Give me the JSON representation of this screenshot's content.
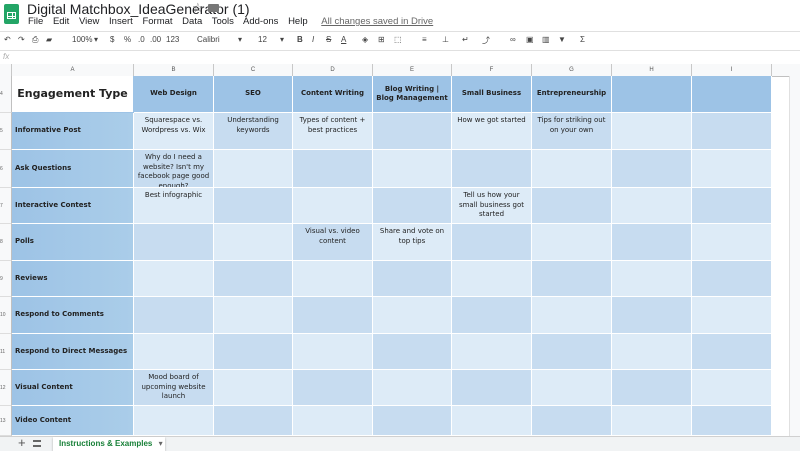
{
  "document": {
    "title": "Digital Matchbox_IdeaGenerator (1)",
    "save_status": "All changes saved in Drive"
  },
  "menu": [
    "File",
    "Edit",
    "View",
    "Insert",
    "Format",
    "Data",
    "Tools",
    "Add-ons",
    "Help"
  ],
  "toolbar": {
    "zoom": "100%",
    "currency": "$",
    "percent": "%",
    "decimal_less": ".0",
    "decimal_more": ".00",
    "more_formats": "123",
    "font": "Calibri",
    "font_size": "12",
    "bold": "B",
    "italic": "I",
    "strike": "S",
    "text_color": "A"
  },
  "formula": {
    "fx": "fx"
  },
  "columns": [
    "A",
    "B",
    "C",
    "D",
    "E",
    "F",
    "G",
    "H",
    "I"
  ],
  "rows": [
    {
      "num": "4",
      "label": "Engagement Type",
      "cells": [
        "Web Design",
        "SEO",
        "Content Writing",
        "Blog Writing | Blog Management",
        "Small Business",
        "Entrepreneurship",
        "",
        ""
      ]
    },
    {
      "num": "5",
      "label": "Informative Post",
      "cells": [
        "Squarespace vs. Wordpress vs. Wix",
        "Understanding keywords",
        "Types of content + best practices",
        "",
        "How we got started",
        "Tips for striking out on your own",
        "",
        ""
      ]
    },
    {
      "num": "6",
      "label": "Ask Questions",
      "cells": [
        "Why do I need a website? Isn't my facebook page good enough?",
        "",
        "",
        "",
        "",
        "",
        "",
        ""
      ]
    },
    {
      "num": "7",
      "label": "Interactive Contest",
      "cells": [
        "Best infographic",
        "",
        "",
        "",
        "Tell us how your small business got started",
        "",
        "",
        ""
      ]
    },
    {
      "num": "8",
      "label": "Polls",
      "cells": [
        "",
        "",
        "Visual vs. video content",
        "Share and vote on top tips",
        "",
        "",
        "",
        ""
      ]
    },
    {
      "num": "9",
      "label": "Reviews",
      "cells": [
        "",
        "",
        "",
        "",
        "",
        "",
        "",
        ""
      ]
    },
    {
      "num": "10",
      "label": "Respond to Comments",
      "cells": [
        "",
        "",
        "",
        "",
        "",
        "",
        "",
        ""
      ]
    },
    {
      "num": "11",
      "label": "Respond to Direct Messages",
      "cells": [
        "",
        "",
        "",
        "",
        "",
        "",
        "",
        ""
      ]
    },
    {
      "num": "12",
      "label": "Visual Content",
      "cells": [
        "Mood board of upcoming website launch",
        "",
        "",
        "",
        "",
        "",
        "",
        ""
      ]
    },
    {
      "num": "13",
      "label": "Video Content",
      "cells": [
        "",
        "",
        "",
        "",
        "",
        "",
        "",
        ""
      ]
    }
  ],
  "sheet_tab": "Instructions & Examples",
  "colors": {
    "header_blue": "#9dc3e6",
    "cell_light": "#ddebf7",
    "cell_mid": "#c7dcf0",
    "tab_green": "#188038"
  }
}
